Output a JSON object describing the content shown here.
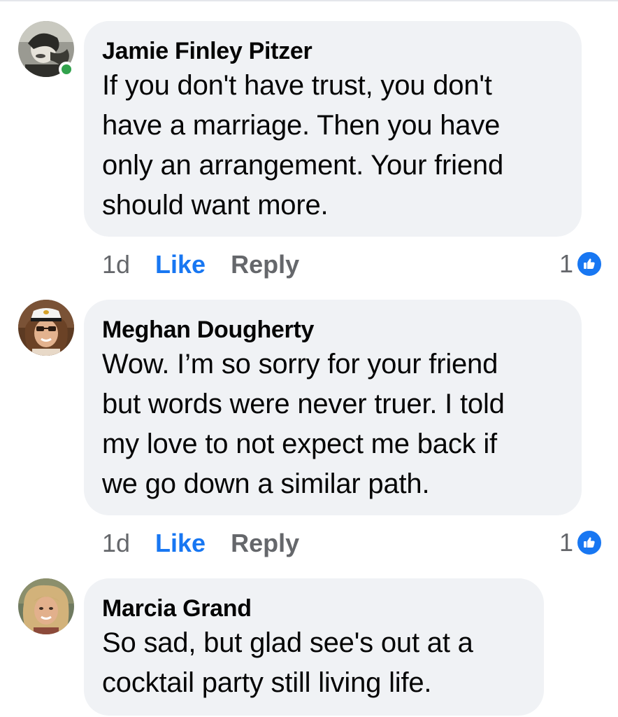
{
  "comments": [
    {
      "author": "Jamie Finley Pitzer",
      "text": "If you don't have trust, you don't\nhave a marriage. Then you have\nonly an arrangement. Your friend\nshould want more.",
      "time": "1d",
      "like_label": "Like",
      "reply_label": "Reply",
      "reaction_count": "1",
      "online": true
    },
    {
      "author": "Meghan Dougherty",
      "text": "Wow. I’m so sorry for your friend\nbut words were never truer. I told\nmy love to not expect me back if\nwe go down a similar path.",
      "time": "1d",
      "like_label": "Like",
      "reply_label": "Reply",
      "reaction_count": "1",
      "online": false
    },
    {
      "author": "Marcia Grand",
      "text": "So sad, but glad see's out at a\ncocktail party still living life.",
      "online": false
    }
  ],
  "colors": {
    "bubble": "#f0f2f5",
    "like_blue": "#1877f2",
    "meta_gray": "#65676b",
    "online_green": "#31a24c"
  },
  "icons": {
    "reaction": "thumbs-up-icon"
  }
}
